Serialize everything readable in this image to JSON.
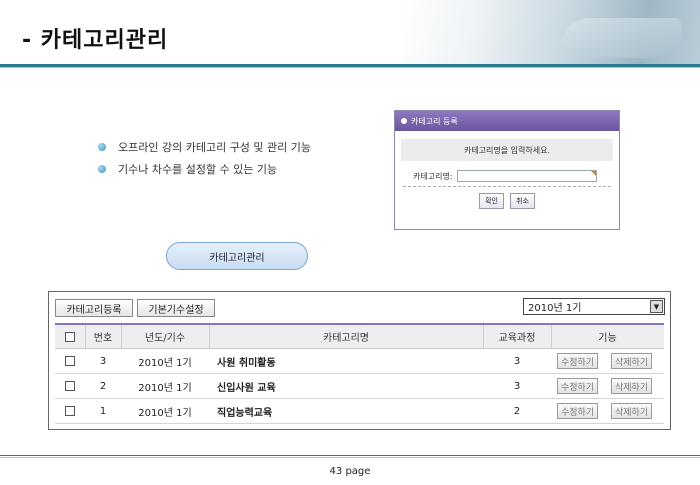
{
  "header": {
    "title": "- 카테고리관리"
  },
  "bullets": [
    "오프라인 강의 카테고리 구성 및 관리 기능",
    "기수나 차수를 설정할 수 있는 기능"
  ],
  "popup": {
    "title": "카테고리 등록",
    "message": "카테고리명을 입력하세요.",
    "field_label": "카테고리명:",
    "confirm": "확인",
    "cancel": "취소"
  },
  "pill_label": "카테고리관리",
  "toolbar": {
    "register": "카테고리등록",
    "base_setting": "기본기수설정",
    "selected_period": "2010년 1기"
  },
  "table": {
    "headers": {
      "no": "번호",
      "period": "년도/기수",
      "name": "카테고리명",
      "courses": "교육과정",
      "function": "기능"
    },
    "rows": [
      {
        "no": "3",
        "period": "2010년 1기",
        "name": "사원 취미활동",
        "courses": "3",
        "edit": "수정하기",
        "delete": "삭제하기"
      },
      {
        "no": "2",
        "period": "2010년 1기",
        "name": "신입사원 교육",
        "courses": "3",
        "edit": "수정하기",
        "delete": "삭제하기"
      },
      {
        "no": "1",
        "period": "2010년 1기",
        "name": "직업능력교육",
        "courses": "2",
        "edit": "수정하기",
        "delete": "삭제하기"
      }
    ]
  },
  "footer": {
    "page": "43 page"
  }
}
